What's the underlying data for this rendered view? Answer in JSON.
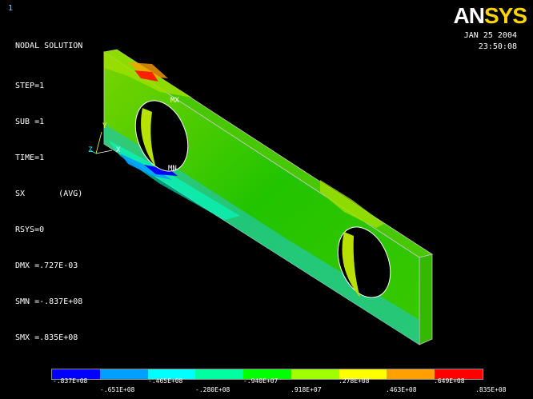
{
  "window": {
    "number": "1"
  },
  "logo": {
    "text_an": "AN",
    "text_sys": "SYS"
  },
  "datetime": {
    "date": "JAN 25 2004",
    "time": "23:50:08"
  },
  "info": {
    "title": "NODAL SOLUTION",
    "lines": [
      "STEP=1",
      "SUB =1",
      "TIME=1",
      "SX       (AVG)",
      "RSYS=0",
      "DMX =.727E-03",
      "SMN =-.837E+08",
      "SMX =.835E+08"
    ]
  },
  "markers": {
    "max": "MX",
    "min": "MN"
  },
  "triad": {
    "x": "X",
    "y": "Y",
    "z": "Z"
  },
  "legend": {
    "colors": [
      "#0000ff",
      "#00a0ff",
      "#00ffff",
      "#00ffa0",
      "#00ff00",
      "#a0ff00",
      "#ffff00",
      "#ffa000",
      "#ff0000"
    ],
    "upper_labels": [
      "-.837E+08",
      "-.465E+08",
      "-.940E+07",
      ".278E+08",
      ".649E+08"
    ],
    "lower_labels": [
      "-.651E+08",
      "-.280E+08",
      ".918E+07",
      ".463E+08",
      ".835E+08"
    ]
  }
}
